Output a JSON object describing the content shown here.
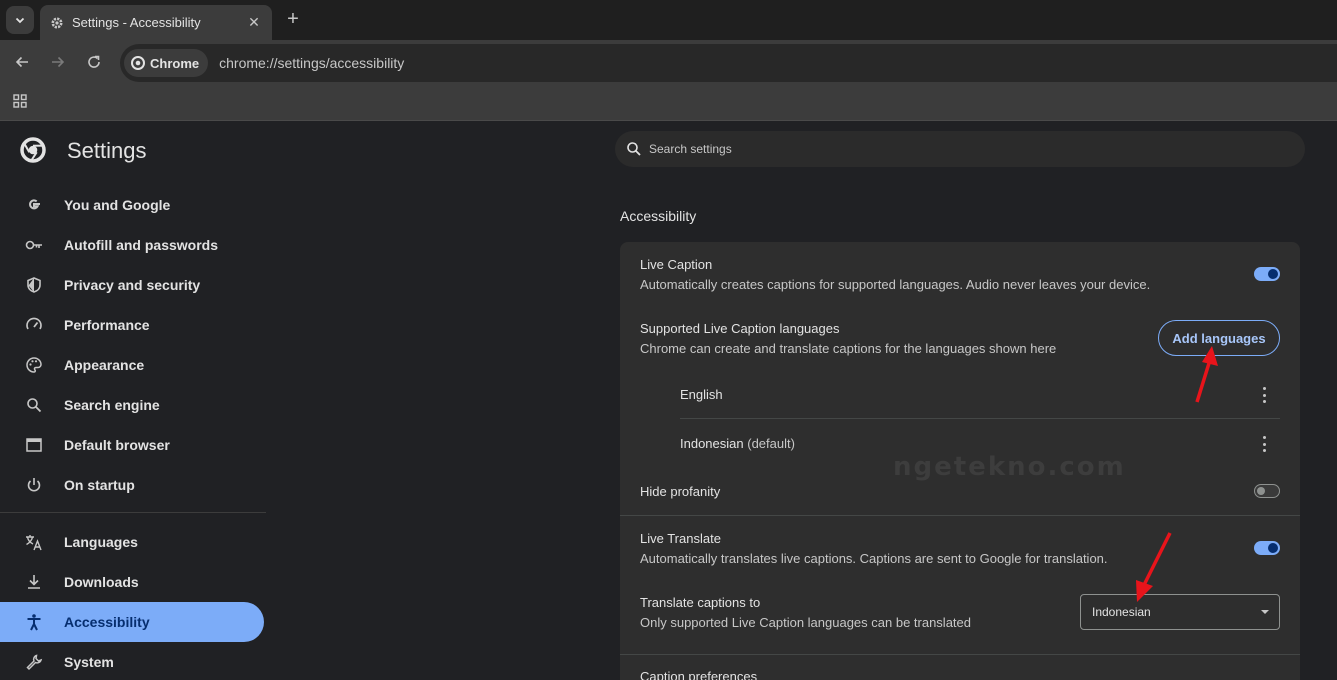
{
  "tab": {
    "title": "Settings - Accessibility",
    "close": "✕",
    "new_tab": "+"
  },
  "omnibox": {
    "chip_label": "Chrome",
    "url": "chrome://settings/accessibility"
  },
  "sidebar": {
    "title": "Settings",
    "items": [
      {
        "label": "You and Google",
        "icon": "google-g-icon"
      },
      {
        "label": "Autofill and passwords",
        "icon": "key-icon"
      },
      {
        "label": "Privacy and security",
        "icon": "shield-icon"
      },
      {
        "label": "Performance",
        "icon": "speedometer-icon"
      },
      {
        "label": "Appearance",
        "icon": "palette-icon"
      },
      {
        "label": "Search engine",
        "icon": "search-icon"
      },
      {
        "label": "Default browser",
        "icon": "browser-window-icon"
      },
      {
        "label": "On startup",
        "icon": "power-icon"
      },
      {
        "label": "Languages",
        "icon": "translate-icon"
      },
      {
        "label": "Downloads",
        "icon": "download-icon"
      },
      {
        "label": "Accessibility",
        "icon": "accessibility-icon",
        "active": true
      },
      {
        "label": "System",
        "icon": "wrench-icon"
      }
    ]
  },
  "search": {
    "placeholder": "Search settings"
  },
  "section": {
    "title": "Accessibility"
  },
  "card": {
    "live_caption": {
      "title": "Live Caption",
      "subtitle": "Automatically creates captions for supported languages. Audio never leaves your device.",
      "enabled": true
    },
    "supported_languages": {
      "title": "Supported Live Caption languages",
      "subtitle": "Chrome can create and translate captions for the languages shown here",
      "button": "Add languages"
    },
    "languages": [
      {
        "name": "English",
        "tag": ""
      },
      {
        "name": "Indonesian",
        "tag": "(default)"
      }
    ],
    "hide_profanity": {
      "title": "Hide profanity",
      "enabled": false
    },
    "live_translate": {
      "title": "Live Translate",
      "subtitle": "Automatically translates live captions. Captions are sent to Google for translation.",
      "enabled": true
    },
    "translate_to": {
      "title": "Translate captions to",
      "subtitle": "Only supported Live Caption languages can be translated",
      "selected": "Indonesian"
    },
    "caption_preferences": {
      "title": "Caption preferences"
    }
  },
  "watermark": "ngetekno.com",
  "colors": {
    "accent": "#7cacf8",
    "annotation_arrow": "#e8141b",
    "background": "#202124"
  }
}
